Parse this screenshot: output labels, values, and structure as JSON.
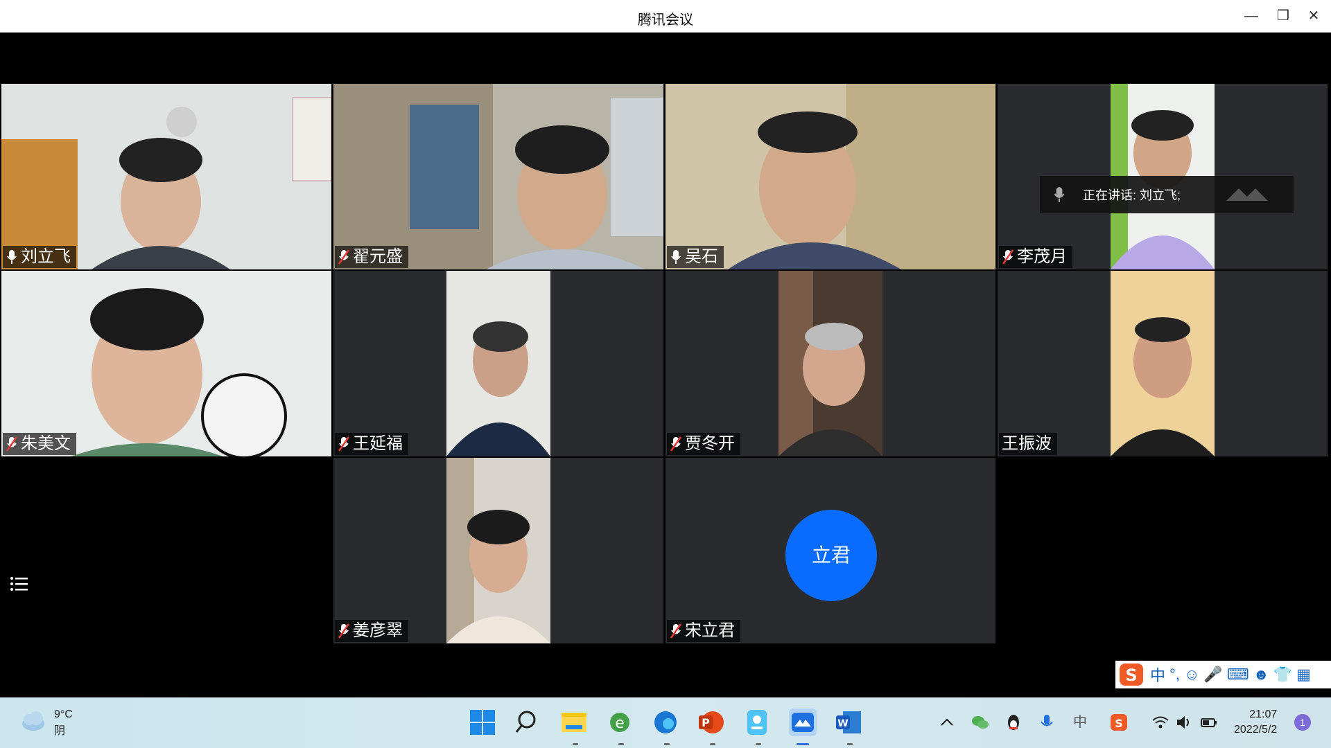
{
  "window": {
    "title": "腾讯会议"
  },
  "speaker_popup": {
    "text": "正在讲话: 刘立飞;"
  },
  "participants": [
    {
      "name": "刘立飞",
      "muted": false,
      "active": true
    },
    {
      "name": "翟元盛",
      "muted": true
    },
    {
      "name": "吴石",
      "muted": false
    },
    {
      "name": "李茂月",
      "muted": true
    },
    {
      "name": "朱美文",
      "muted": true
    },
    {
      "name": "王延福",
      "muted": true
    },
    {
      "name": "贾冬开",
      "muted": true
    },
    {
      "name": "王振波",
      "muted": false
    },
    {
      "name": "姜彦翠",
      "muted": true
    },
    {
      "name": "宋立君",
      "muted": true,
      "avatar_text": "立君"
    }
  ],
  "ime": {
    "mode": "中",
    "punct": "°,"
  },
  "taskbar": {
    "weather_temp": "9°C",
    "weather_desc": "阴",
    "ime_indicator": "中",
    "time": "21:07",
    "date": "2022/5/2",
    "notification_count": "1"
  },
  "colors": {
    "accent": "#0a6cff",
    "active_border": "#2fbf71"
  }
}
